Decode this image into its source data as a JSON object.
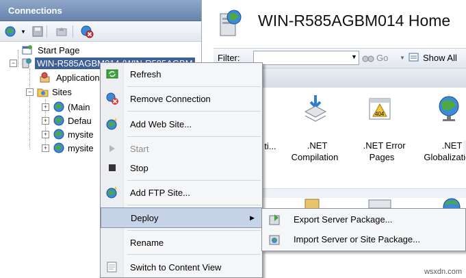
{
  "connections": {
    "title": "Connections",
    "tree": {
      "start_page": "Start Page",
      "server": "WIN-R585AGBM014 (WIN-R585AGBM",
      "application_pools": "Application",
      "sites": "Sites",
      "site_items": [
        "(Main",
        "Defau",
        "mysite",
        "mysite"
      ]
    }
  },
  "home": {
    "title": "WIN-R585AGBM014 Home",
    "filter_label": "Filter:",
    "go_label": "Go",
    "show_all_label": "Show All",
    "group_label": "r",
    "features": [
      {
        "label": "ti...",
        "icon": "auth-icon"
      },
      {
        "label": ".NET\nCompilation",
        "icon": "compilation-icon"
      },
      {
        "label": ".NET Error\nPages",
        "icon": "error-pages-icon"
      },
      {
        "label": ".NET\nGlobalization",
        "icon": "globe-icon"
      },
      {
        "label": "...",
        "icon": "generic-icon"
      }
    ]
  },
  "context_menu": {
    "items": [
      {
        "label": "Refresh",
        "icon": "refresh-icon",
        "enabled": true
      },
      {
        "label": "Remove Connection",
        "icon": "remove-connection-icon",
        "enabled": true
      },
      {
        "label": "Add Web Site...",
        "icon": "add-website-icon",
        "enabled": true
      },
      {
        "label": "Start",
        "icon": "play-icon",
        "enabled": false
      },
      {
        "label": "Stop",
        "icon": "stop-icon",
        "enabled": true
      },
      {
        "label": "Add FTP Site...",
        "icon": "add-ftp-icon",
        "enabled": true
      },
      {
        "label": "Deploy",
        "icon": "",
        "enabled": true,
        "has_submenu": true
      },
      {
        "label": "Rename",
        "icon": "",
        "enabled": true
      },
      {
        "label": "Switch to Content View",
        "icon": "content-view-icon",
        "enabled": true
      }
    ]
  },
  "deploy_submenu": {
    "items": [
      {
        "label": "Export Server Package...",
        "icon": "export-package-icon"
      },
      {
        "label": "Import Server or Site Package...",
        "icon": "import-package-icon"
      }
    ]
  },
  "watermark": "wsxdn.com",
  "colors": {
    "header_blue": "#6784ae",
    "selection_blue": "#3f5f99",
    "menu_highlight": "#c7d3e6"
  }
}
